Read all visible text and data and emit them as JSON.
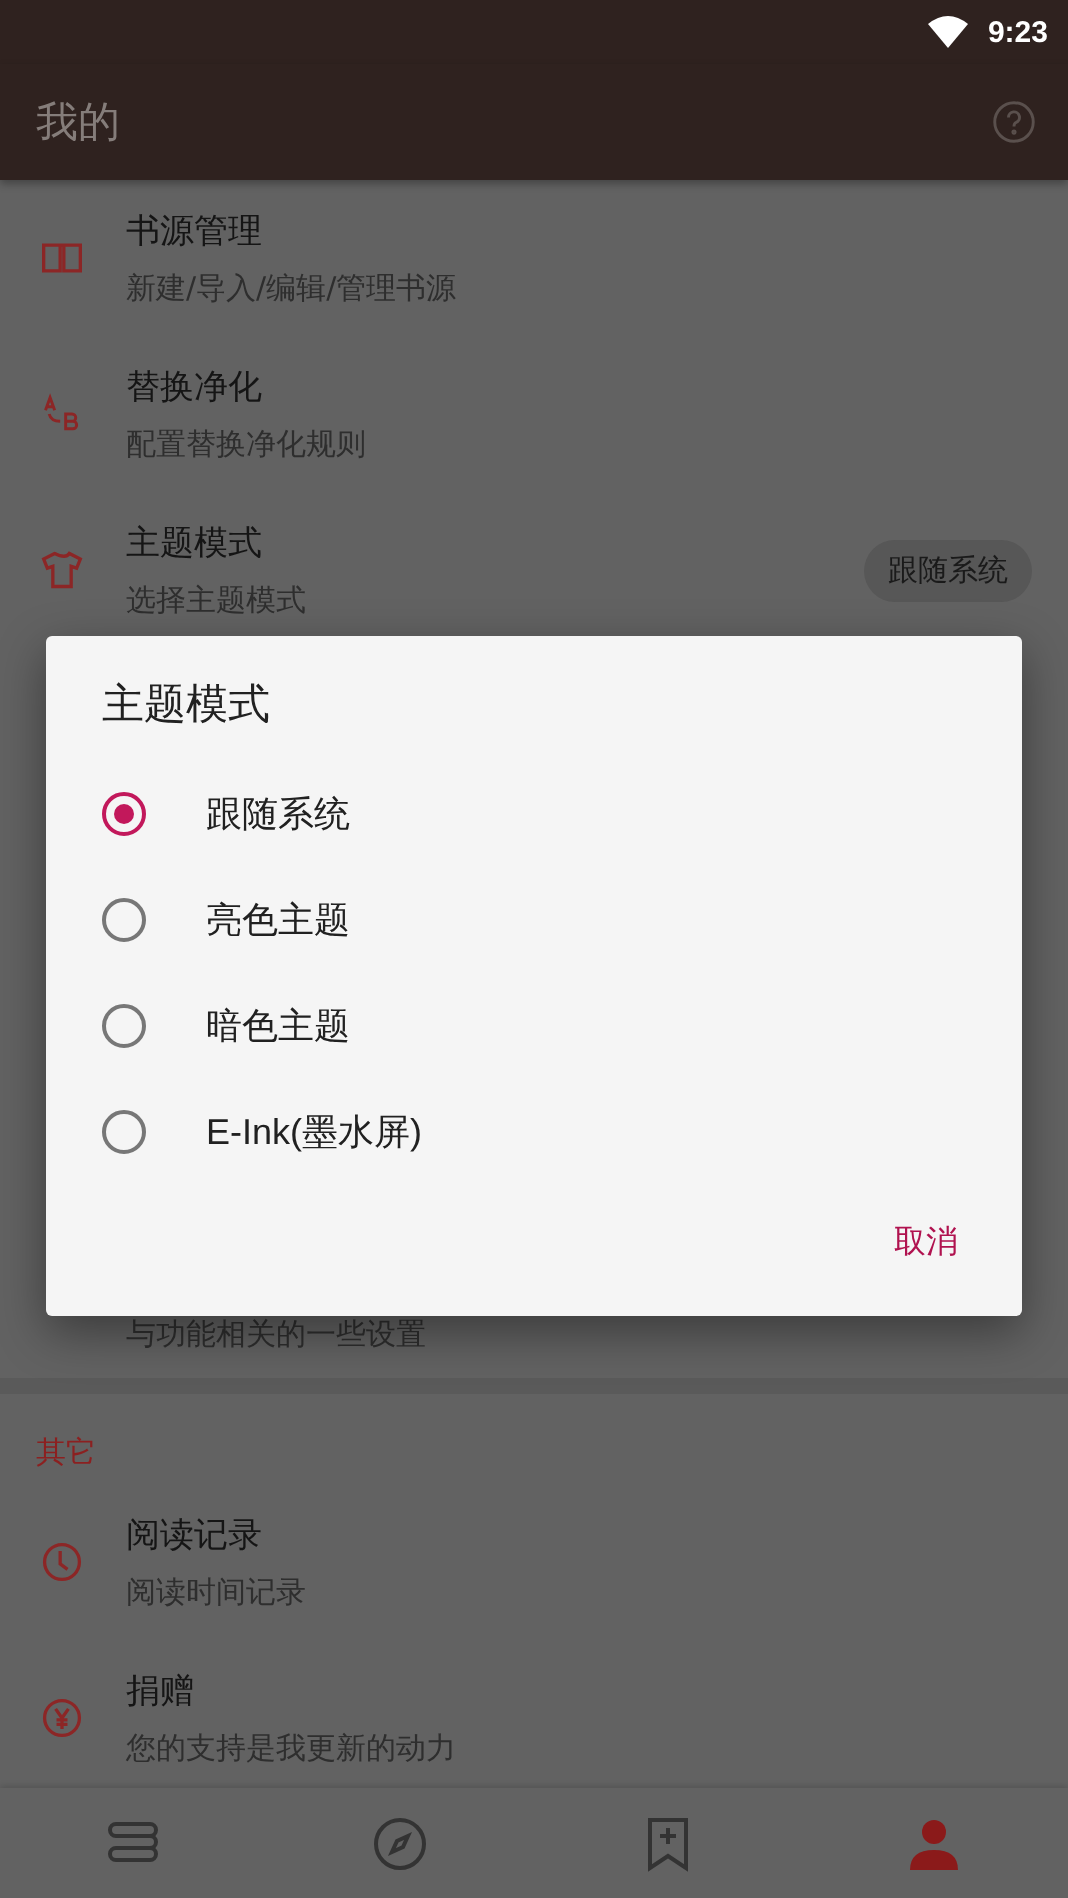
{
  "status_bar": {
    "time": "9:23"
  },
  "app_bar": {
    "title": "我的"
  },
  "items": [
    {
      "title": "书源管理",
      "subtitle": "新建/导入/编辑/管理书源"
    },
    {
      "title": "替换净化",
      "subtitle": "配置替换净化规则"
    },
    {
      "title": "主题模式",
      "subtitle": "选择主题模式",
      "value": "跟随系统"
    }
  ],
  "partly_hidden_item": {
    "subtitle": "与功能相关的一些设置"
  },
  "sections": [
    {
      "header": "其它",
      "items": [
        {
          "title": "阅读记录",
          "subtitle": "阅读时间记录"
        },
        {
          "title": "捐赠",
          "subtitle": "您的支持是我更新的动力"
        }
      ]
    }
  ],
  "bottom_nav": [
    {
      "selected": false
    },
    {
      "selected": false
    },
    {
      "selected": false
    },
    {
      "selected": true
    }
  ],
  "dialog": {
    "title": "主题模式",
    "options": [
      {
        "label": "跟随系统",
        "selected": true
      },
      {
        "label": "亮色主题",
        "selected": false
      },
      {
        "label": "暗色主题",
        "selected": false
      },
      {
        "label": "E-Ink(墨水屏)",
        "selected": false
      }
    ],
    "buttons": [
      "取消"
    ]
  }
}
